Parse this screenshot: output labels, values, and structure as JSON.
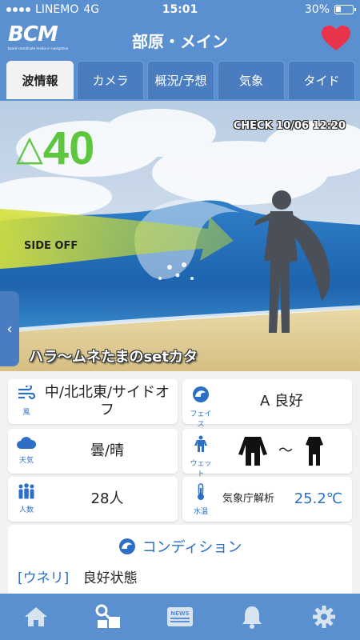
{
  "status_bar": {
    "carrier": "LINEMO",
    "network": "4G",
    "time": "15:01",
    "battery": "30%"
  },
  "header": {
    "logo_text": "BCM",
    "logo_sub": "board coordinate media in navigation",
    "title": "部原・メイン"
  },
  "tabs": [
    {
      "label": "波情報",
      "active": true
    },
    {
      "label": "カメラ",
      "active": false
    },
    {
      "label": "概況/予想",
      "active": false
    },
    {
      "label": "気象",
      "active": false
    },
    {
      "label": "タイド",
      "active": false
    }
  ],
  "wave": {
    "check_time": "CHECK 10/06 12:20",
    "rating_symbol": "△",
    "rating_value": "40",
    "wind_direction_label": "SIDE OFF",
    "comment": "ハラ〜ムネたまのsetカタ",
    "prev_arrow": "‹"
  },
  "conditions": {
    "wind": {
      "label": "風",
      "value": "中/北北東/サイドオフ",
      "icon": "wind-icon"
    },
    "face": {
      "label": "フェイス",
      "value": "A 良好",
      "icon": "wave-face-icon"
    },
    "weather": {
      "label": "天気",
      "value": "曇/晴",
      "icon": "cloud-icon"
    },
    "wetsuit": {
      "label": "ウェット",
      "separator": "〜",
      "icon": "wetsuit-icon"
    },
    "people": {
      "label": "人数",
      "value": "28人",
      "icon": "people-icon"
    },
    "water_temp": {
      "label": "水温",
      "source": "気象庁解析",
      "value": "25.2℃",
      "icon": "thermometer-icon"
    }
  },
  "condition_section": {
    "title": "コンディション",
    "rows": [
      {
        "key": "[ウネリ]",
        "value": "良好状態"
      }
    ]
  },
  "bottom_nav": [
    "home-icon",
    "surf-point-icon",
    "news-icon",
    "bell-icon",
    "settings-icon"
  ],
  "colors": {
    "accent": "#5a8fd0",
    "rating": "#5cc63d",
    "water_temp": "#2d6fc4"
  }
}
